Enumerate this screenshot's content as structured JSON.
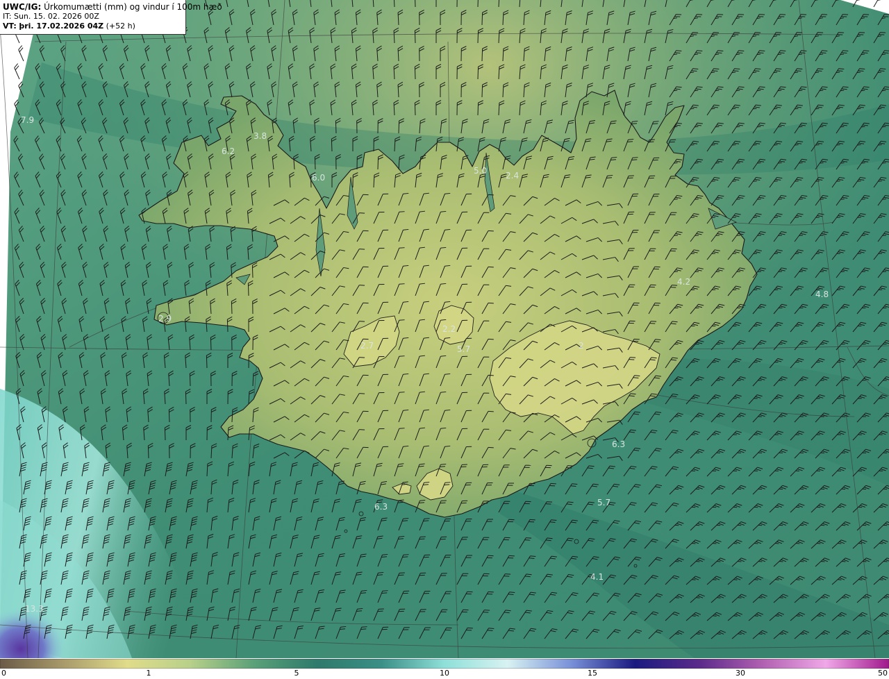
{
  "header": {
    "model_label": "UWC/IG:",
    "title_text": "Úrkomumætti (mm) og vindur í 100m hæð",
    "it_label": "IT:",
    "it_text": "Sun. 15. 02. 2026 00Z",
    "vt_label": "VT:",
    "vt_date": "þri. 17.02.2026 04Z",
    "vt_offset": "(+52 h)"
  },
  "legend": {
    "ticks": [
      "0",
      "1",
      "5",
      "10",
      "15",
      "30",
      "50"
    ],
    "colors": [
      "#6b5a47",
      "#a89a6a",
      "#e0dc8a",
      "#b8d08a",
      "#5aa078",
      "#2e7a6c",
      "#3a8f86",
      "#8ee0d8",
      "#d8f2f2",
      "#7890d8",
      "#1a1a80",
      "#5a2a8a",
      "#b060b0",
      "#f0a8e8",
      "#a0188c"
    ]
  },
  "map": {
    "value_labels": [
      "7.9",
      "3.8",
      "6.2",
      "6.0",
      "5.0",
      "2.4",
      "4.2",
      "4.8",
      "2.9",
      "2.7",
      "2.2",
      "5.7",
      "2",
      "6.3",
      "6.3",
      "5.7",
      "4.1",
      "13.3"
    ]
  }
}
